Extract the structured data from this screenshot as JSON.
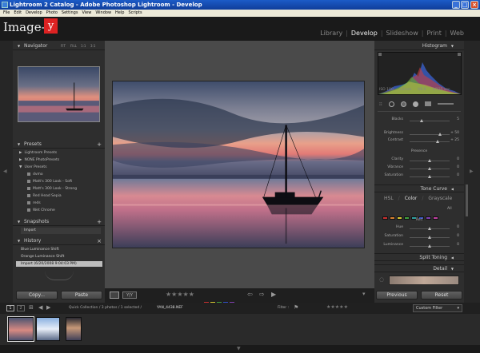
{
  "window": {
    "title": "Lightroom 2 Catalog - Adobe Photoshop Lightroom - Develop"
  },
  "menu": [
    "File",
    "Edit",
    "Develop",
    "Photo",
    "Settings",
    "View",
    "Window",
    "Help",
    "Scripts"
  ],
  "identity": {
    "logo_text": "Image-",
    "logo_mark": "y"
  },
  "modules": [
    {
      "label": "Library",
      "active": false
    },
    {
      "label": "Develop",
      "active": true
    },
    {
      "label": "Slideshow",
      "active": false
    },
    {
      "label": "Print",
      "active": false
    },
    {
      "label": "Web",
      "active": false
    }
  ],
  "navigator": {
    "title": "Navigator",
    "zoom_options": [
      "FIT",
      "FILL",
      "1:1",
      "3:1"
    ]
  },
  "presets": {
    "title": "Presets",
    "items": [
      {
        "label": "Lightroom Presets",
        "level": 0
      },
      {
        "label": "NONE PhotoPresets",
        "level": 0
      },
      {
        "label": "User Presets",
        "level": 0
      },
      {
        "label": "dvmo",
        "level": 1
      },
      {
        "label": "Matt's 300 Look - Soft",
        "level": 1
      },
      {
        "label": "Matt's 300 Look - Strong",
        "level": 1
      },
      {
        "label": "Red Head Sepia",
        "level": 1
      },
      {
        "label": "reds",
        "level": 1
      },
      {
        "label": "Wet Chrome",
        "level": 1
      }
    ]
  },
  "snapshots": {
    "title": "Snapshots",
    "items": [
      "Import"
    ]
  },
  "history": {
    "title": "History",
    "items": [
      {
        "label": "Blue Luminance Shift",
        "selected": false
      },
      {
        "label": "Orange Luminance Shift",
        "selected": false
      },
      {
        "label": "Import (6/20/2008 9:04:03 PM)",
        "selected": true
      }
    ]
  },
  "left_buttons": {
    "copy": "Copy...",
    "paste": "Paste"
  },
  "histogram": {
    "title": "Histogram",
    "readout": [
      "ISO 100",
      "22mm",
      "f/8.0",
      "1/125 sec"
    ]
  },
  "tone": {
    "sliders": [
      {
        "label": "Blacks",
        "value": "5",
        "position": 0.3
      },
      {
        "label": "Brightness",
        "value": "+ 50",
        "position": 0.75
      },
      {
        "label": "Contrast",
        "value": "+ 25",
        "position": 0.7
      }
    ],
    "presence_label": "Presence",
    "presence": [
      {
        "label": "Clarity",
        "value": "0",
        "position": 0.5
      },
      {
        "label": "Vibrance",
        "value": "0",
        "position": 0.5
      },
      {
        "label": "Saturation",
        "value": "0",
        "position": 0.5
      }
    ]
  },
  "tone_curve": {
    "title": "Tone Curve"
  },
  "hsl": {
    "tabs": [
      "HSL",
      "Color",
      "Grayscale"
    ],
    "swatch_colors": [
      "#c83030",
      "#d88030",
      "#d8c830",
      "#40a040",
      "#30a0a0",
      "#3050c8",
      "#8040b0",
      "#c040a0"
    ],
    "all_label": "All",
    "group_label": "Red",
    "sliders": [
      {
        "label": "Hue",
        "value": "0",
        "position": 0.5
      },
      {
        "label": "Saturation",
        "value": "0",
        "position": 0.5
      },
      {
        "label": "Luminance",
        "value": "0",
        "position": 0.5
      }
    ]
  },
  "split_toning": {
    "title": "Split Toning"
  },
  "detail": {
    "title": "Detail"
  },
  "right_buttons": {
    "previous": "Previous",
    "reset": "Reset"
  },
  "filmstrip_bar": {
    "page_buttons": [
      "1",
      "2"
    ],
    "path": "Quick Collection / 3 photos / 1 selected /",
    "filename": "YAN_4438.NEF",
    "filter_label": "Filter :",
    "custom_filter": "Custom Filter"
  },
  "toolbar": {
    "rating_stars": 5,
    "label_colors": [
      "#c83030",
      "#d8c830",
      "#40a040",
      "#3050c8",
      "#8040b0"
    ]
  }
}
